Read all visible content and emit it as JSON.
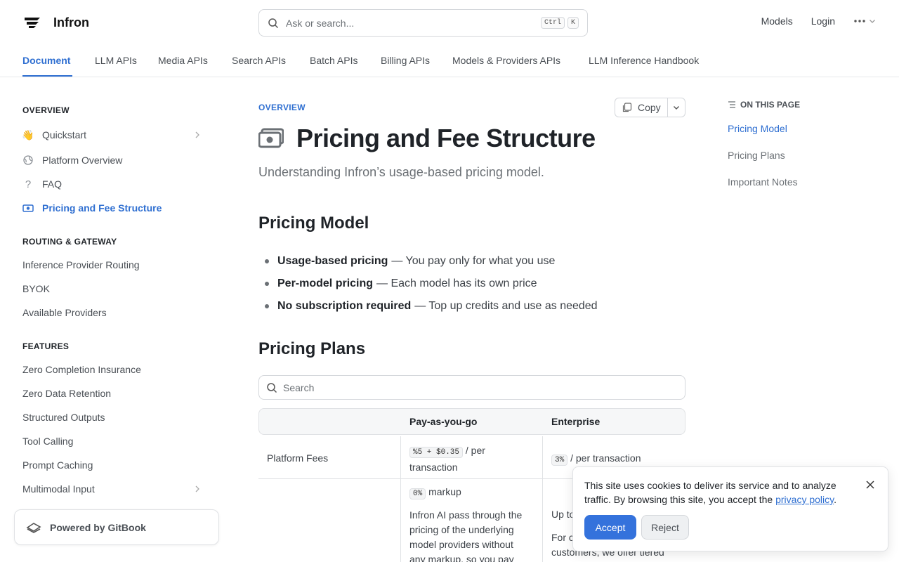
{
  "header": {
    "brand": "Infron",
    "search_placeholder": "Ask or search...",
    "kbd_ctrl": "Ctrl",
    "kbd_k": "K",
    "links": [
      "Models",
      "Login"
    ]
  },
  "tabs": [
    "Document",
    "LLM APIs",
    "Media APIs",
    "Search APIs",
    "Batch APIs",
    "Billing APIs",
    "Models & Providers APIs",
    "LLM Inference Handbook"
  ],
  "sidebar": {
    "sections": [
      {
        "title": "OVERVIEW",
        "items": [
          "Quickstart",
          "Platform Overview",
          "FAQ",
          "Pricing and Fee Structure"
        ]
      },
      {
        "title": "ROUTING & GATEWAY",
        "items": [
          "Inference Provider Routing",
          "BYOK",
          "Available Providers"
        ]
      },
      {
        "title": "FEATURES",
        "items": [
          "Zero Completion Insurance",
          "Zero Data Retention",
          "Structured Outputs",
          "Tool Calling",
          "Prompt Caching",
          "Multimodal Input"
        ]
      }
    ],
    "powered_by": "Powered by GitBook"
  },
  "main": {
    "breadcrumb": "OVERVIEW",
    "copy_label": "Copy",
    "title": "Pricing and Fee Structure",
    "subtitle": "Understanding Infron’s usage-based pricing model.",
    "section1": "Pricing Model",
    "bullets": [
      {
        "bold": "Usage-based pricing",
        "text": "— You pay only for what you use"
      },
      {
        "bold": "Per-model pricing",
        "text": "— Each model has its own price"
      },
      {
        "bold": "No subscription required",
        "text": "— Top up credits and use as needed"
      }
    ],
    "section2": "Pricing Plans",
    "table_search_placeholder": "Search",
    "table": {
      "headers": [
        "",
        "Pay-as-you-go",
        "Enterprise"
      ],
      "row1_label": "Platform Fees",
      "row1_payg_code": "%5 + $0.35",
      "row1_payg_line1": "/ per",
      "row1_payg_line2": "transaction",
      "row1_ent_code": "3%",
      "row1_ent_text": "/ per transaction",
      "row2_payg_code": "0%",
      "row2_payg_text": "markup",
      "row2_payg_desc_lines": [
        "Infron AI pass through the",
        "pricing of the underlying",
        "model providers without",
        "any markup, so you pay"
      ],
      "row2_ent_line1": "Up to",
      "row2_ent_line2": "For c",
      "row2_ent_line3": "customers, we offer tiered"
    }
  },
  "toc": {
    "heading": "ON THIS PAGE",
    "items": [
      "Pricing Model",
      "Pricing Plans",
      "Important Notes"
    ]
  },
  "cookie": {
    "message": "This site uses cookies to deliver its service and to analyze traffic. By browsing this site, you accept the",
    "link": "privacy policy",
    "after_link": ".",
    "accept": "Accept",
    "reject": "Reject"
  },
  "colors": {
    "accent": "#2f6fd1",
    "accept_button": "#3472dc"
  }
}
